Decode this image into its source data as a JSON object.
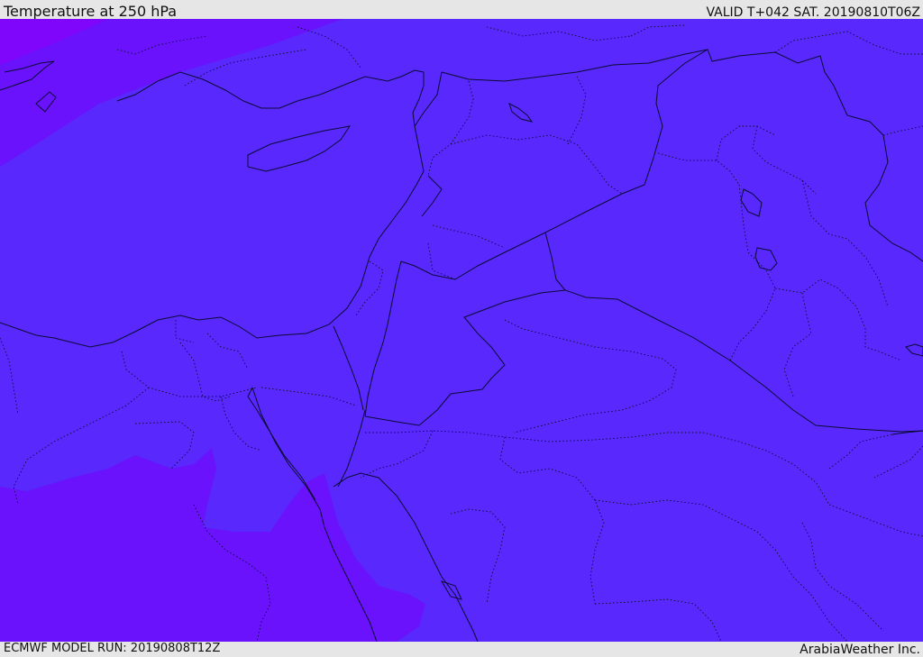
{
  "header": {
    "title": "Temperature at 250 hPa",
    "valid_time": "VALID T+042 SAT. 20190810T06Z"
  },
  "footer": {
    "model_run": "ECMWF MODEL RUN: 20190808T12Z",
    "credit": "ArabiaWeather Inc."
  },
  "colors": {
    "main_field": "#5828fd",
    "warm_field": "#6a12fb",
    "warmest_field": "#7f06fb",
    "lines": "#0b0b33",
    "bars": "#e6e6e6"
  }
}
